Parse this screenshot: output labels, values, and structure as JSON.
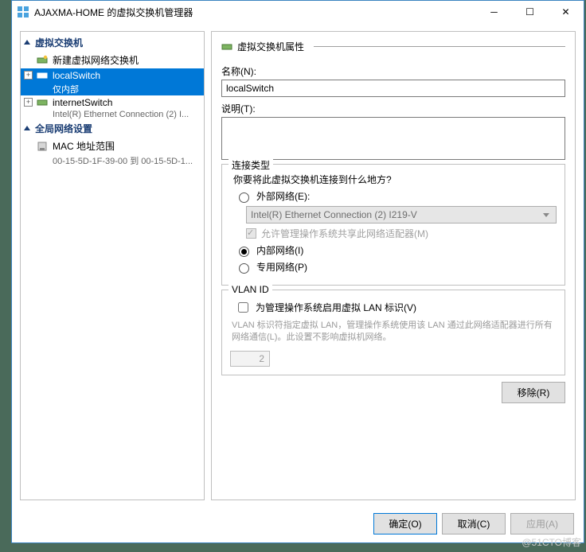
{
  "window": {
    "title": "AJAXMA-HOME 的虚拟交换机管理器"
  },
  "tree": {
    "group1": "虚拟交换机",
    "item_new": "新建虚拟网络交换机",
    "item_local": "localSwitch",
    "item_local_sub": "仅内部",
    "item_internet": "internetSwitch",
    "item_internet_sub": "Intel(R) Ethernet Connection (2) I...",
    "group2": "全局网络设置",
    "item_mac": "MAC 地址范围",
    "item_mac_sub": "00-15-5D-1F-39-00 到 00-15-5D-1..."
  },
  "props": {
    "header": "虚拟交换机属性",
    "name_label": "名称(N):",
    "name_value": "localSwitch",
    "desc_label": "说明(T):",
    "desc_value": ""
  },
  "conn": {
    "legend": "连接类型",
    "question": "你要将此虚拟交换机连接到什么地方?",
    "ext_label": "外部网络(E):",
    "ext_adapter": "Intel(R) Ethernet Connection (2) I219-V",
    "ext_share": "允许管理操作系统共享此网络适配器(M)",
    "internal_label": "内部网络(I)",
    "private_label": "专用网络(P)"
  },
  "vlan": {
    "legend": "VLAN ID",
    "enable_label": "为管理操作系统启用虚拟 LAN 标识(V)",
    "help": "VLAN 标识符指定虚拟 LAN，管理操作系统使用该 LAN 通过此网络适配器进行所有网络通信(L)。此设置不影响虚拟机网络。",
    "value": "2"
  },
  "buttons": {
    "remove": "移除(R)",
    "ok": "确定(O)",
    "cancel": "取消(C)",
    "apply": "应用(A)"
  },
  "watermark": "@51CTO博客"
}
